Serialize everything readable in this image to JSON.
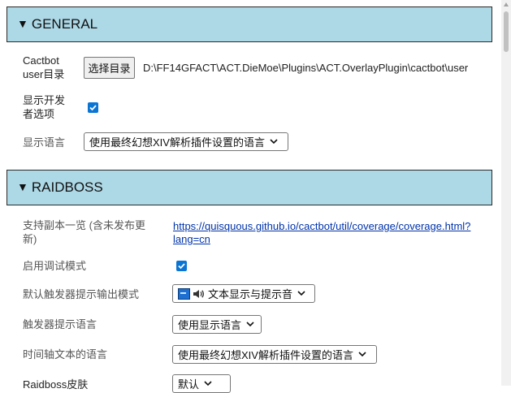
{
  "general": {
    "header": "GENERAL",
    "user_dir_label_1": "Cactbot",
    "user_dir_label_2": "user目录",
    "choose_dir_button": "选择目录",
    "user_dir_path": "D:\\FF14GFACT\\ACT.DieMoe\\Plugins\\ACT.OverlayPlugin\\cactbot\\user",
    "dev_options_label_1": "显示开发",
    "dev_options_label_2": "者选项",
    "dev_options_checked": true,
    "display_language_label": "显示语言",
    "display_language_value": "使用最终幻想XIV解析插件设置的语言"
  },
  "raidboss": {
    "header": "RAIDBOSS",
    "coverage_label_1": "支持副本一览 (含未发布更",
    "coverage_label_2": "新)",
    "coverage_link_1": "https://quisquous.github.io/cactbot/util/coverage/coverage.html?",
    "coverage_link_2": "lang=cn",
    "debug_mode_label": "启用调试模式",
    "debug_mode_checked": true,
    "default_output_label": "默认触发器提示输出模式",
    "default_output_value": "文本显示与提示音",
    "trigger_language_label": "触发器提示语言",
    "trigger_language_value": "使用显示语言",
    "timeline_language_label": "时间轴文本的语言",
    "timeline_language_value": "使用最终幻想XIV解析插件设置的语言",
    "skin_label": "Raidboss皮肤",
    "skin_value": "默认"
  },
  "colors": {
    "header_bg": "#add8e6",
    "checkbox": "#0b75d4",
    "link": "#0033aa"
  }
}
